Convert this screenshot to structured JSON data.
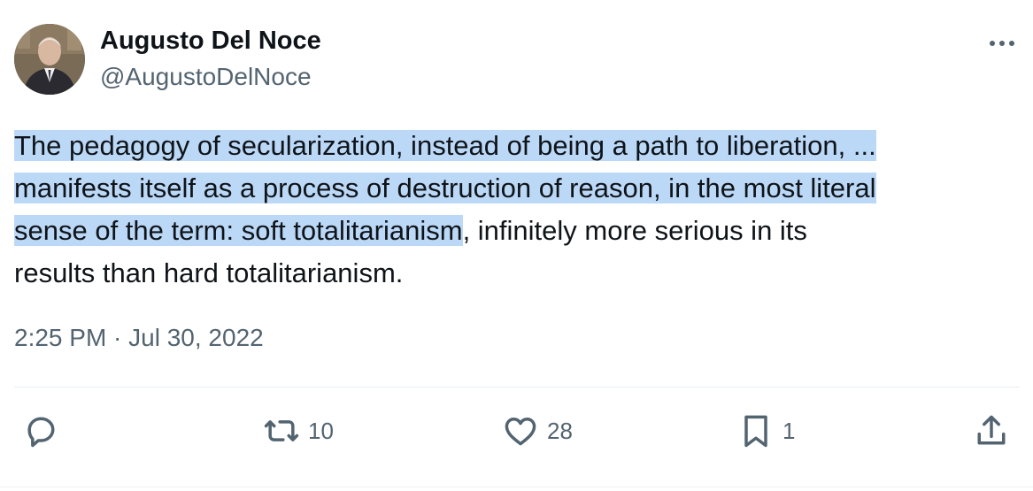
{
  "author": {
    "name": "Augusto Del Noce",
    "handle": "@AugustoDelNoce"
  },
  "tweet": {
    "line1_highlighted": "The pedagogy of secularization, instead of being a path to liberation, ...",
    "line2_highlighted": "manifests itself as a process of destruction of reason, in the most literal",
    "line3_highlighted": "sense of the term: soft totalitarianism",
    "line3_plain": ", infinitely more serious in its",
    "line4_plain": "results than hard totalitarianism.",
    "highlight_color": "#bcd8f7",
    "timestamp": "2:25 PM · Jul 30, 2022"
  },
  "actions": {
    "reply": {
      "icon": "reply-icon",
      "count": ""
    },
    "retweet": {
      "icon": "retweet-icon",
      "count": "10"
    },
    "like": {
      "icon": "heart-icon",
      "count": "28"
    },
    "bookmark": {
      "icon": "bookmark-icon",
      "count": "1"
    },
    "share": {
      "icon": "share-icon",
      "count": ""
    }
  },
  "colors": {
    "primary_text": "#0f1419",
    "secondary_text": "#536471",
    "divider": "#e6ecf0"
  }
}
